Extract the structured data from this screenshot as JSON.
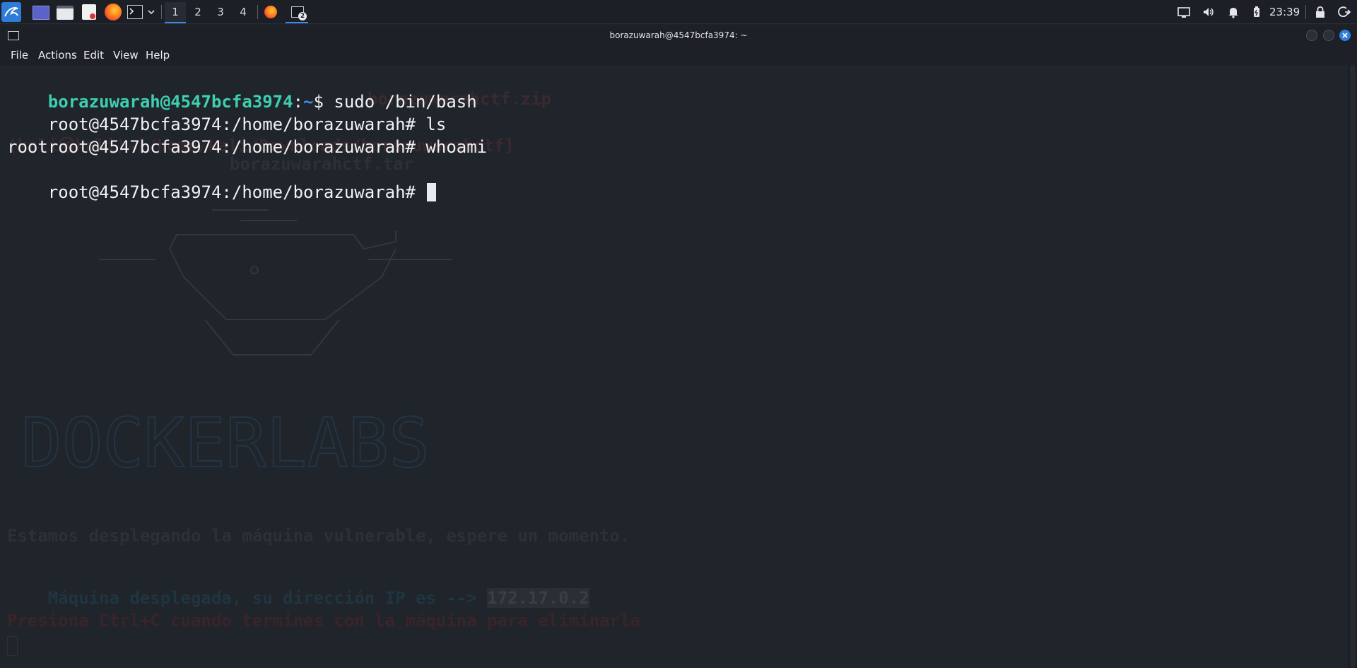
{
  "taskbar": {
    "workspaces": [
      "1",
      "2",
      "3",
      "4"
    ],
    "active_workspace": "1",
    "terminal_badge": "2",
    "clock": "23:39"
  },
  "window": {
    "title": "borazuwarah@4547bcfa3974: ~",
    "menu": [
      "File",
      "Actions",
      "Edit",
      "View",
      "Help"
    ]
  },
  "terminal": {
    "prompt_user": "borazuwarah@4547bcfa3974",
    "prompt_sep": ":",
    "prompt_dir": "~",
    "prompt_char": "$ ",
    "command1": "sudo /bin/bash",
    "root_prompt": "root@4547bcfa3974:/home/borazuwarah# ",
    "command2": "ls",
    "command3": "whoami",
    "output1": "root",
    "root_prompt_final": "root@4547bcfa3974:/home/borazuwarah# "
  },
  "background_text": {
    "zip_line": "borazuwarahctf.zip",
    "path_line": "(kali㉿kali)-[/home/kali/Downloads/borazuwarahctf]",
    "tar_line": "borazuwarahctf.tar",
    "logo": "DOCKERLABS",
    "deploy_msg": "Estamos desplegando la máquina vulnerable, espere un momento.",
    "ip_msg": "Máquina desplegada, su dirección IP es --> ",
    "ip": "172.17.0.2",
    "exit_msg": "Presiona Ctrl+C cuando termines con la máquina para eliminarla"
  },
  "colors": {
    "terminal_bg": "#20242b",
    "user_prompt": "#3ecfb0",
    "dir_prompt": "#3f8ff0",
    "accent": "#3d8ae8"
  }
}
